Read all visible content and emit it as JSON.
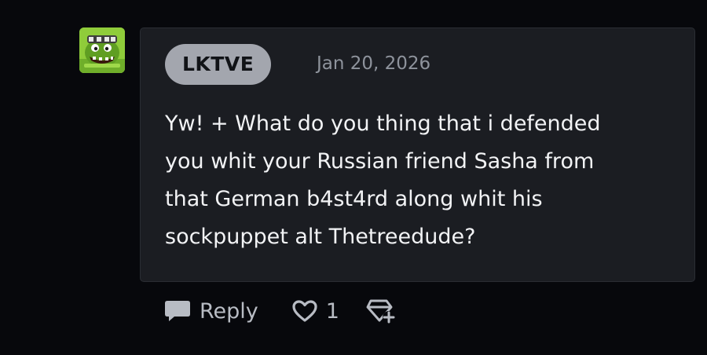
{
  "comment": {
    "author": "LKTVE",
    "date": "Jan 20, 2026",
    "text": "Yw! + What do you thing that i defended\nyou whit your Russian friend Sasha from\nthat German b4st4rd along whit his\nsockpuppet alt Thetreedude?"
  },
  "actions": {
    "reply_label": "Reply",
    "like_count": "1"
  },
  "icons": {
    "reply": "speech-bubble-icon",
    "like": "heart-icon",
    "award": "award-plus-icon"
  },
  "colors": {
    "background": "#07080c",
    "bubble": "#1b1d22",
    "username_pill": "#a3a6ae",
    "action_text": "#b8bcc4",
    "avatar_green": "#8fcc3a"
  }
}
